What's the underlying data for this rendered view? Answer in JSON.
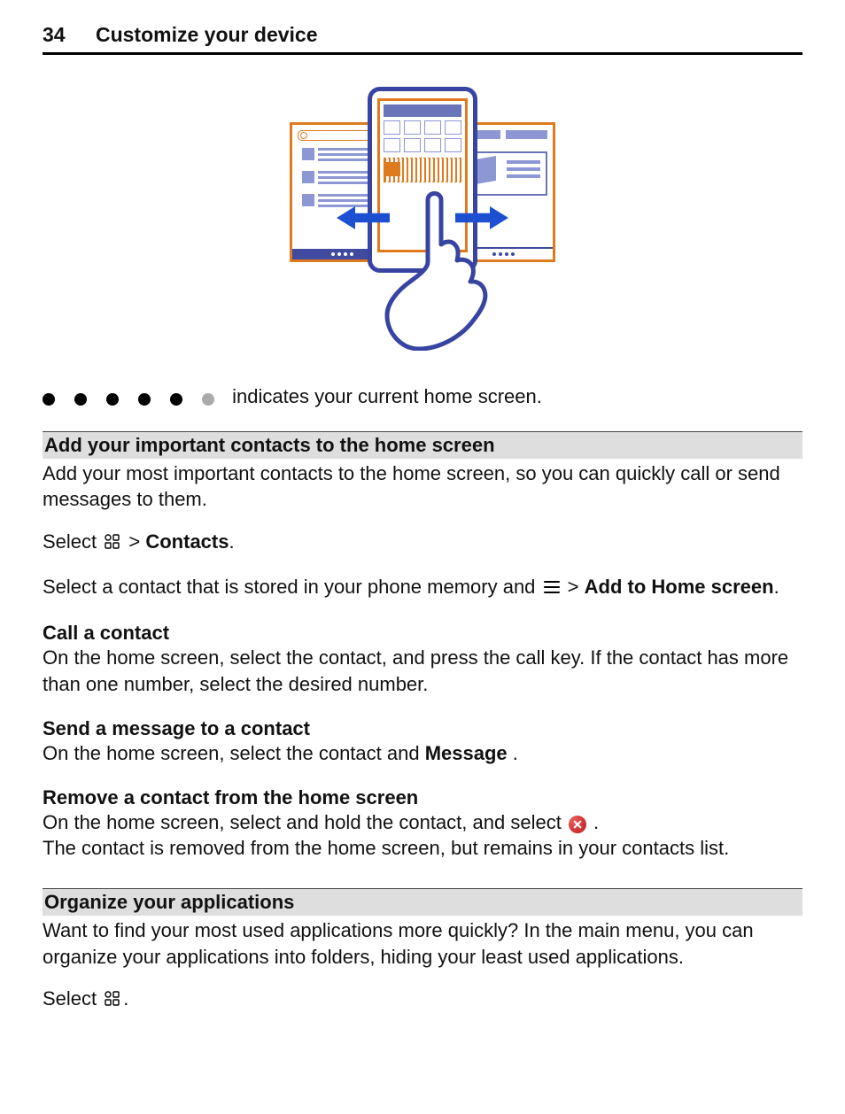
{
  "header": {
    "page_number": "34",
    "section_title": "Customize your device"
  },
  "indicator_sentence": "indicates your current home screen.",
  "sections": {
    "add_contacts": {
      "title": "Add your important contacts to the home screen",
      "intro": "Add your most important contacts to the home screen, so you can quickly call or send messages to them.",
      "select_prefix": "Select ",
      "select_suffix_chevron": " > ",
      "select_target": "Contacts",
      "period": ".",
      "step2_a": "Select a contact that is stored in your phone memory and ",
      "step2_chevron": " > ",
      "step2_target": "Add to Home screen",
      "call_h": "Call a contact",
      "call_body": "On the home screen, select the contact, and press the call key. If the contact has more than one number, select the desired number.",
      "msg_h": "Send a message to a contact",
      "msg_body_a": "On the home screen, select the contact and ",
      "msg_body_b": "Message",
      "msg_body_c": ".",
      "rm_h": "Remove a contact from the home screen",
      "rm_body_a": "On the home screen, select and hold the contact, and select ",
      "rm_body_b": ".",
      "rm_body2": "The contact is removed from the home screen, but remains in your contacts list."
    },
    "organize": {
      "title": "Organize your applications",
      "body": "Want to find your most used applications more quickly? In the main menu, you can organize your applications into folders, hiding your least used applications.",
      "select_prefix": "Select ",
      "period": "."
    }
  }
}
